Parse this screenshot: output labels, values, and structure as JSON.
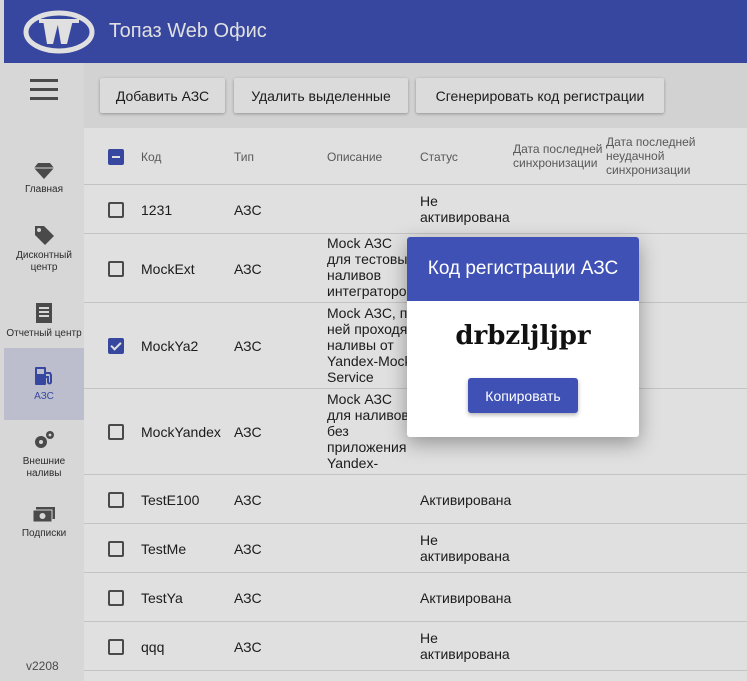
{
  "app": {
    "title": "Топаз Web Офис",
    "version": "v2208",
    "accent": "#3f51b5"
  },
  "sidebar": {
    "items": [
      {
        "label": "Главная",
        "icon": "diamond-icon"
      },
      {
        "label": "Дисконтный центр",
        "icon": "tag-icon"
      },
      {
        "label": "Отчетный центр",
        "icon": "report-icon"
      },
      {
        "label": "АЗС",
        "icon": "gas-station-icon",
        "active": true
      },
      {
        "label": "Внешние наливы",
        "icon": "gears-icon"
      },
      {
        "label": "Подписки",
        "icon": "money-icon"
      }
    ]
  },
  "toolbar": {
    "add_label": "Добавить АЗС",
    "delete_label": "Удалить выделенные",
    "generate_label": "Сгенерировать код регистрации"
  },
  "table": {
    "headers": {
      "code": "Код",
      "type": "Тип",
      "description": "Описание",
      "status": "Статус",
      "last_sync": "Дата последней синхронизации",
      "last_failed_sync": "Дата последней неудачной синхронизации"
    },
    "rows": [
      {
        "code": "1231",
        "type": "АЗС",
        "description": "",
        "status": "Не активирована",
        "checked": false
      },
      {
        "code": "MockExt",
        "type": "АЗС",
        "description": "Mock АЗС для тестовых наливов интеграторов",
        "status": "",
        "checked": false
      },
      {
        "code": "MockYa2",
        "type": "АЗС",
        "description": "Mock АЗС, по ней проходят наливы от Yandex-Mock Service",
        "status": "",
        "checked": true
      },
      {
        "code": "MockYandex",
        "type": "АЗС",
        "description": "Mock АЗС для наливов без приложения Yandex-Заправки",
        "status": "",
        "checked": false
      },
      {
        "code": "TestE100",
        "type": "АЗС",
        "description": "",
        "status": "Активирована",
        "checked": false
      },
      {
        "code": "TestMe",
        "type": "АЗС",
        "description": "",
        "status": "Не активирована",
        "checked": false
      },
      {
        "code": "TestYa",
        "type": "АЗС",
        "description": "",
        "status": "Активирована",
        "checked": false
      },
      {
        "code": "qqq",
        "type": "АЗС",
        "description": "",
        "status": "Не активирована",
        "checked": false
      }
    ]
  },
  "dialog": {
    "title": "Код регистрации АЗС",
    "code": "drbzljljpr",
    "copy_label": "Копировать"
  }
}
